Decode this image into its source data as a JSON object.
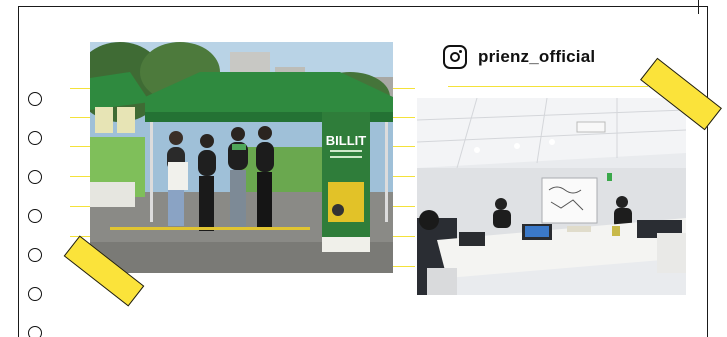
{
  "profile": {
    "handle": "prienz_official",
    "icon": "instagram-icon"
  },
  "photo_event": {
    "banner_title": "BILLIT",
    "icon": "booth-photo"
  },
  "photo_meeting": {
    "icon": "meeting-room-photo"
  },
  "colors": {
    "tape": "#fbe33a",
    "guide_line": "#f4e23a",
    "tent_green": "#2f8a3f",
    "frame": "#1a1a1a"
  }
}
